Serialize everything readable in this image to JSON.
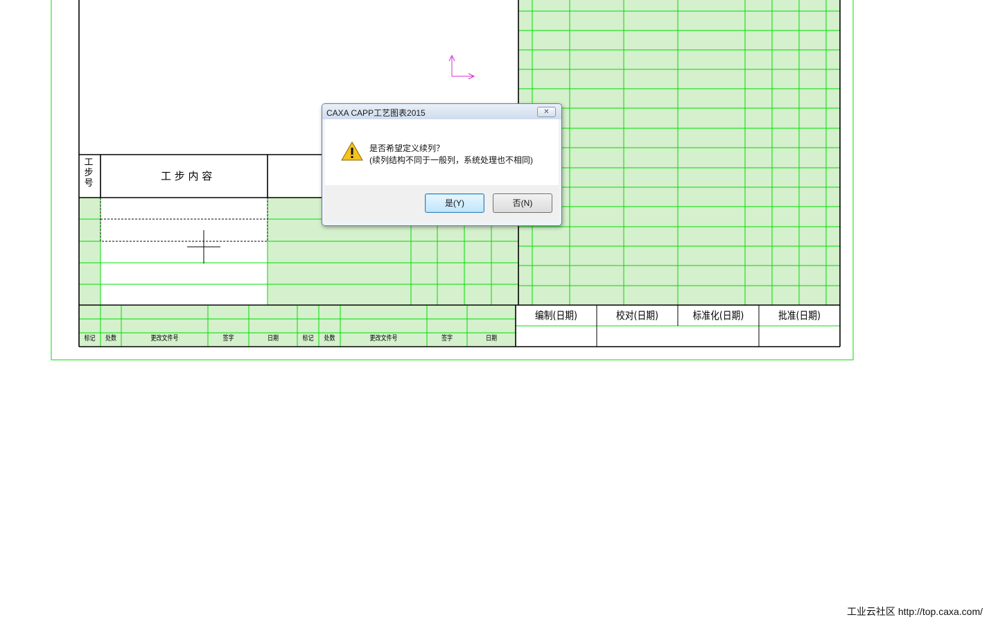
{
  "form": {
    "step_no_header": "工步号",
    "step_content_header": "工 步 内 容",
    "revision_labels": [
      "标记",
      "处数",
      "更改文件号",
      "签字",
      "日期",
      "标记",
      "处数",
      "更改文件号",
      "签字",
      "日期"
    ],
    "signoff_labels": [
      "编制(日期)",
      "校对(日期)",
      "标准化(日期)",
      "批准(日期)"
    ]
  },
  "dialog": {
    "title": "CAXA CAPP工艺图表2015",
    "close_label": "✕",
    "icon": "warning-icon",
    "message_line1": "是否希望定义续列？",
    "message_line2": "(续列结构不同于一般列，系统处理也不相同)",
    "yes_label": "是(Y)",
    "no_label": "否(N)"
  },
  "watermark": "工业云社区 http://top.caxa.com/",
  "colors": {
    "grid_green": "#00dd00",
    "fill_green": "#d4f0cc",
    "ucs_magenta": "#d42bd4"
  }
}
